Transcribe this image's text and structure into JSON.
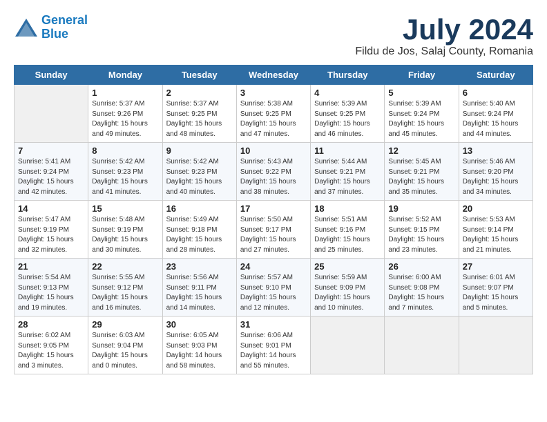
{
  "header": {
    "logo_line1": "General",
    "logo_line2": "Blue",
    "month_year": "July 2024",
    "location": "Fildu de Jos, Salaj County, Romania"
  },
  "days_of_week": [
    "Sunday",
    "Monday",
    "Tuesday",
    "Wednesday",
    "Thursday",
    "Friday",
    "Saturday"
  ],
  "weeks": [
    [
      {
        "day": "",
        "info": ""
      },
      {
        "day": "1",
        "info": "Sunrise: 5:37 AM\nSunset: 9:26 PM\nDaylight: 15 hours\nand 49 minutes."
      },
      {
        "day": "2",
        "info": "Sunrise: 5:37 AM\nSunset: 9:25 PM\nDaylight: 15 hours\nand 48 minutes."
      },
      {
        "day": "3",
        "info": "Sunrise: 5:38 AM\nSunset: 9:25 PM\nDaylight: 15 hours\nand 47 minutes."
      },
      {
        "day": "4",
        "info": "Sunrise: 5:39 AM\nSunset: 9:25 PM\nDaylight: 15 hours\nand 46 minutes."
      },
      {
        "day": "5",
        "info": "Sunrise: 5:39 AM\nSunset: 9:24 PM\nDaylight: 15 hours\nand 45 minutes."
      },
      {
        "day": "6",
        "info": "Sunrise: 5:40 AM\nSunset: 9:24 PM\nDaylight: 15 hours\nand 44 minutes."
      }
    ],
    [
      {
        "day": "7",
        "info": "Sunrise: 5:41 AM\nSunset: 9:24 PM\nDaylight: 15 hours\nand 42 minutes."
      },
      {
        "day": "8",
        "info": "Sunrise: 5:42 AM\nSunset: 9:23 PM\nDaylight: 15 hours\nand 41 minutes."
      },
      {
        "day": "9",
        "info": "Sunrise: 5:42 AM\nSunset: 9:23 PM\nDaylight: 15 hours\nand 40 minutes."
      },
      {
        "day": "10",
        "info": "Sunrise: 5:43 AM\nSunset: 9:22 PM\nDaylight: 15 hours\nand 38 minutes."
      },
      {
        "day": "11",
        "info": "Sunrise: 5:44 AM\nSunset: 9:21 PM\nDaylight: 15 hours\nand 37 minutes."
      },
      {
        "day": "12",
        "info": "Sunrise: 5:45 AM\nSunset: 9:21 PM\nDaylight: 15 hours\nand 35 minutes."
      },
      {
        "day": "13",
        "info": "Sunrise: 5:46 AM\nSunset: 9:20 PM\nDaylight: 15 hours\nand 34 minutes."
      }
    ],
    [
      {
        "day": "14",
        "info": "Sunrise: 5:47 AM\nSunset: 9:19 PM\nDaylight: 15 hours\nand 32 minutes."
      },
      {
        "day": "15",
        "info": "Sunrise: 5:48 AM\nSunset: 9:19 PM\nDaylight: 15 hours\nand 30 minutes."
      },
      {
        "day": "16",
        "info": "Sunrise: 5:49 AM\nSunset: 9:18 PM\nDaylight: 15 hours\nand 28 minutes."
      },
      {
        "day": "17",
        "info": "Sunrise: 5:50 AM\nSunset: 9:17 PM\nDaylight: 15 hours\nand 27 minutes."
      },
      {
        "day": "18",
        "info": "Sunrise: 5:51 AM\nSunset: 9:16 PM\nDaylight: 15 hours\nand 25 minutes."
      },
      {
        "day": "19",
        "info": "Sunrise: 5:52 AM\nSunset: 9:15 PM\nDaylight: 15 hours\nand 23 minutes."
      },
      {
        "day": "20",
        "info": "Sunrise: 5:53 AM\nSunset: 9:14 PM\nDaylight: 15 hours\nand 21 minutes."
      }
    ],
    [
      {
        "day": "21",
        "info": "Sunrise: 5:54 AM\nSunset: 9:13 PM\nDaylight: 15 hours\nand 19 minutes."
      },
      {
        "day": "22",
        "info": "Sunrise: 5:55 AM\nSunset: 9:12 PM\nDaylight: 15 hours\nand 16 minutes."
      },
      {
        "day": "23",
        "info": "Sunrise: 5:56 AM\nSunset: 9:11 PM\nDaylight: 15 hours\nand 14 minutes."
      },
      {
        "day": "24",
        "info": "Sunrise: 5:57 AM\nSunset: 9:10 PM\nDaylight: 15 hours\nand 12 minutes."
      },
      {
        "day": "25",
        "info": "Sunrise: 5:59 AM\nSunset: 9:09 PM\nDaylight: 15 hours\nand 10 minutes."
      },
      {
        "day": "26",
        "info": "Sunrise: 6:00 AM\nSunset: 9:08 PM\nDaylight: 15 hours\nand 7 minutes."
      },
      {
        "day": "27",
        "info": "Sunrise: 6:01 AM\nSunset: 9:07 PM\nDaylight: 15 hours\nand 5 minutes."
      }
    ],
    [
      {
        "day": "28",
        "info": "Sunrise: 6:02 AM\nSunset: 9:05 PM\nDaylight: 15 hours\nand 3 minutes."
      },
      {
        "day": "29",
        "info": "Sunrise: 6:03 AM\nSunset: 9:04 PM\nDaylight: 15 hours\nand 0 minutes."
      },
      {
        "day": "30",
        "info": "Sunrise: 6:05 AM\nSunset: 9:03 PM\nDaylight: 14 hours\nand 58 minutes."
      },
      {
        "day": "31",
        "info": "Sunrise: 6:06 AM\nSunset: 9:01 PM\nDaylight: 14 hours\nand 55 minutes."
      },
      {
        "day": "",
        "info": ""
      },
      {
        "day": "",
        "info": ""
      },
      {
        "day": "",
        "info": ""
      }
    ]
  ]
}
